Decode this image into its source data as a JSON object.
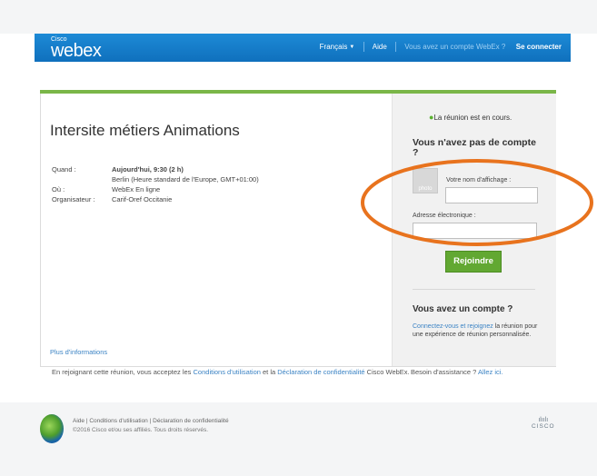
{
  "header": {
    "logo_cisco": "Cisco",
    "logo_webex": "webex",
    "language": "Français",
    "help": "Aide",
    "account_question": "Vous avez un compte WebEx ?",
    "signin": "Se connecter",
    "accent_color": "#1d8ad6"
  },
  "meeting": {
    "title": "Intersite métiers Animations",
    "when_label": "Quand :",
    "when_value": "Aujourd'hui, 9:30  (2 h)",
    "timezone": "Berlin (Heure standard de l'Europe, GMT+01:00)",
    "where_label": "Où :",
    "where_value": "WebEx En ligne",
    "host_label": "Organisateur :",
    "host_value": "Carif-Oref Occitanie",
    "more_info": "Plus d'informations"
  },
  "join_panel": {
    "status": "La réunion est en cours.",
    "status_color": "#5bb230",
    "no_account_title": "Vous n'avez pas de compte ?",
    "avatar_text": "photo",
    "display_name_label": "Votre nom d'affichage :",
    "display_name_value": "",
    "email_label": "Adresse électronique :",
    "email_value": "",
    "join_button": "Rejoindre",
    "join_color": "#62a832",
    "have_account_title": "Vous avez un compte ?",
    "signin_link": "Connectez-vous et rejoignez",
    "signin_text": " la réunion pour une expérience de réunion personnalisée."
  },
  "terms": {
    "prefix": "En rejoignant cette réunion, vous acceptez les ",
    "terms_link": "Conditions d'utilisation",
    "middle": " et la ",
    "privacy_link": "Déclaration de confidentialité",
    "suffix": " Cisco WebEx.",
    "help_prefix": "Besoin d'assistance ? ",
    "help_link": "Allez ici."
  },
  "footer": {
    "help": "Aide",
    "terms": "Conditions d'utilisation",
    "privacy": "Déclaration de confidentialité",
    "copyright": "©2016 Cisco et/ou ses affiliés. Tous droits réservés.",
    "cisco_bars": "ılıılı",
    "cisco_word": "CISCO"
  },
  "annotation_color": "#e8731e"
}
